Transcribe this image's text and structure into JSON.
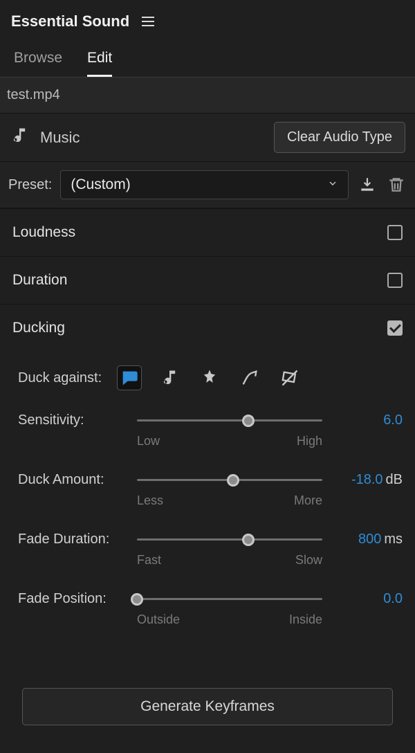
{
  "panel": {
    "title": "Essential Sound"
  },
  "tabs": {
    "browse": "Browse",
    "edit": "Edit"
  },
  "file": {
    "name": "test.mp4"
  },
  "audio_type": {
    "label": "Music",
    "clear_btn": "Clear Audio Type"
  },
  "preset": {
    "label": "Preset:",
    "value": "(Custom)"
  },
  "sections": {
    "loudness": {
      "title": "Loudness",
      "enabled": false
    },
    "duration": {
      "title": "Duration",
      "enabled": false
    },
    "ducking": {
      "title": "Ducking",
      "enabled": true
    }
  },
  "duck_against": {
    "label": "Duck against:",
    "icons": [
      "dialogue-icon",
      "music-icon",
      "sfx-icon",
      "ambience-icon",
      "unassigned-icon"
    ],
    "selected": 0
  },
  "sliders": {
    "sensitivity": {
      "label": "Sensitivity:",
      "value": "6.0",
      "unit": "",
      "hint_low": "Low",
      "hint_high": "High",
      "percent": 60
    },
    "duck_amount": {
      "label": "Duck Amount:",
      "value": "-18.0",
      "unit": "dB",
      "hint_low": "Less",
      "hint_high": "More",
      "percent": 52
    },
    "fade_duration": {
      "label": "Fade Duration:",
      "value": "800",
      "unit": "ms",
      "hint_low": "Fast",
      "hint_high": "Slow",
      "percent": 60
    },
    "fade_position": {
      "label": "Fade Position:",
      "value": "0.0",
      "unit": "",
      "hint_low": "Outside",
      "hint_high": "Inside",
      "percent": 0
    }
  },
  "generate_btn": "Generate Keyframes"
}
